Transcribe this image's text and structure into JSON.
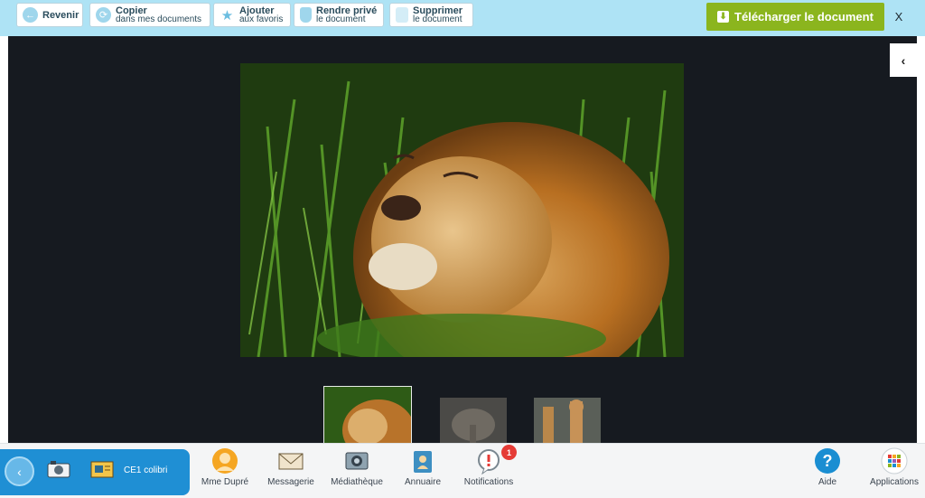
{
  "toolbar": {
    "back_label": "Revenir",
    "copy_line1": "Copier",
    "copy_line2": "dans mes documents",
    "fav_line1": "Ajouter",
    "fav_line2": "aux favoris",
    "private_line1": "Rendre privé",
    "private_line2": "le document",
    "delete_line1": "Supprimer",
    "delete_line2": "le document",
    "download_label": "Télécharger le document",
    "close_label": "X"
  },
  "viewer": {
    "side_toggle_glyph": "‹"
  },
  "dock": {
    "back_glyph": "‹",
    "class_label": "CE1 colibri",
    "items": [
      {
        "label": "Mme Dupré"
      },
      {
        "label": "Messagerie"
      },
      {
        "label": "Médiathèque"
      },
      {
        "label": "Annuaire"
      },
      {
        "label": "Notifications",
        "badge": "1"
      },
      {
        "label": "Aide"
      },
      {
        "label": "Applications"
      }
    ]
  },
  "colors": {
    "toolbar_bg": "#aee3f5",
    "download_green": "#8bb51e",
    "viewer_bg": "#161a20",
    "dock_blue": "#1f8fd4",
    "badge_red": "#e53b36"
  }
}
